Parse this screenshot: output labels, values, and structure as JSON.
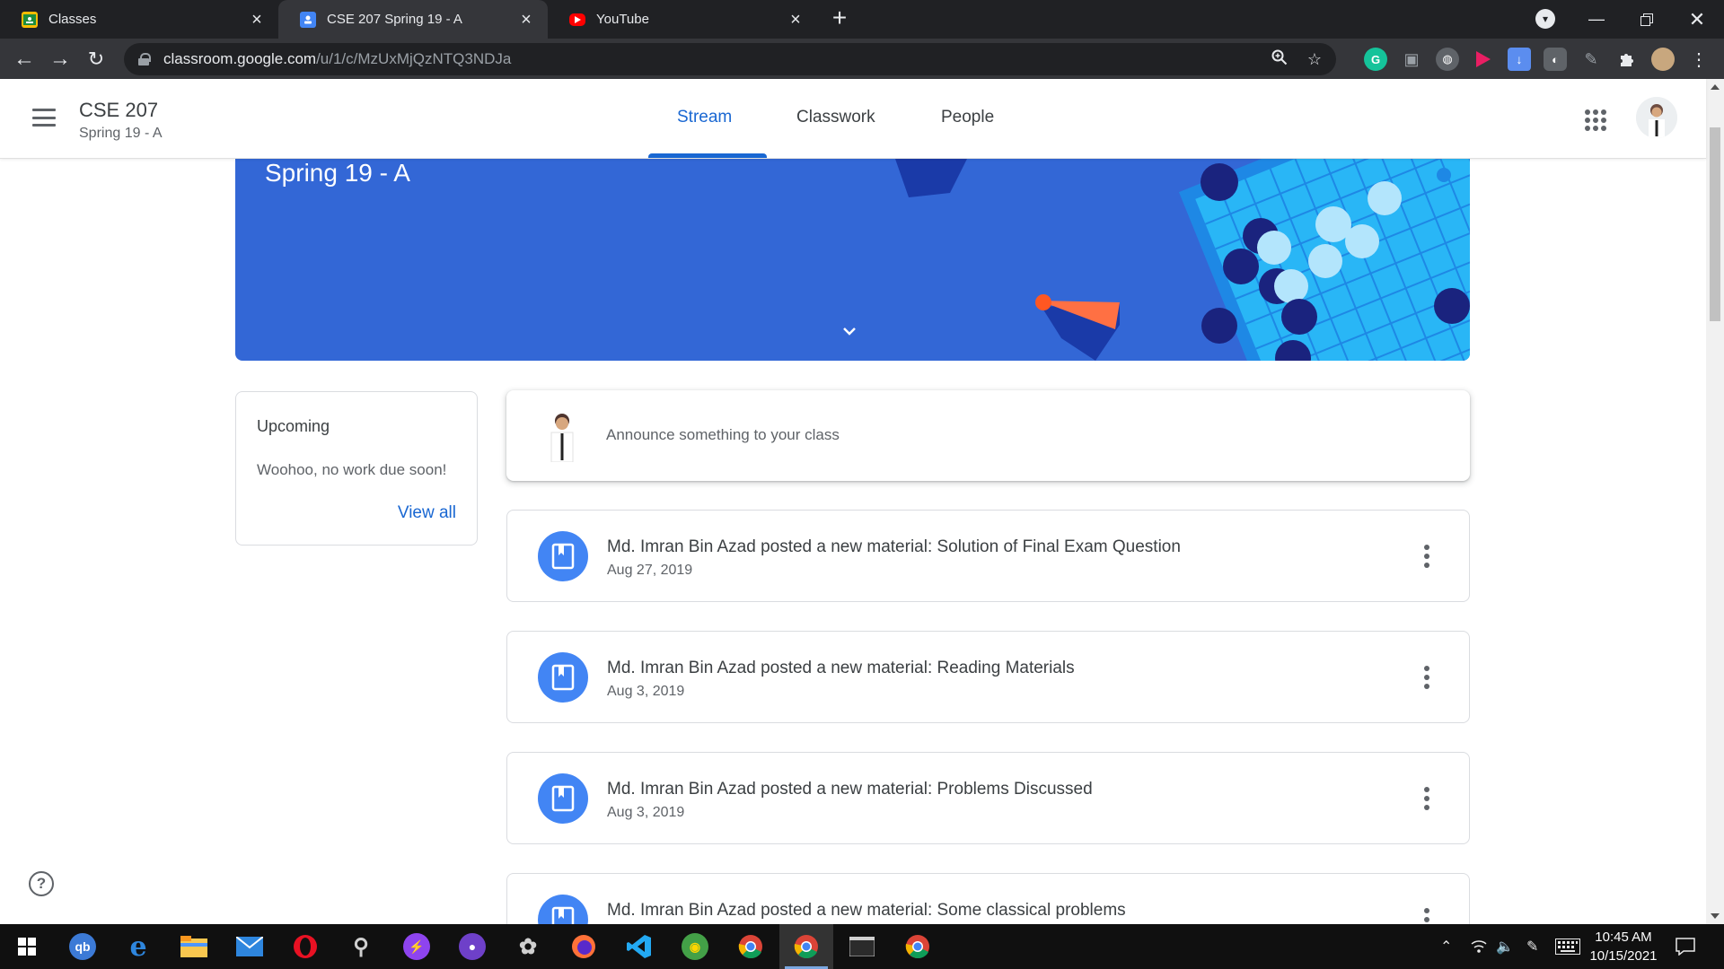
{
  "browser": {
    "tabs": [
      {
        "title": "Classes",
        "favicon_color": "#fbbc04"
      },
      {
        "title": "CSE 207 Spring 19 - A",
        "favicon_color": "#4285f4"
      },
      {
        "title": "YouTube",
        "favicon_color": "#ff0000"
      }
    ],
    "url_host": "classroom.google.com",
    "url_path": "/u/1/c/MzUxMjQzNTQ3NDJa"
  },
  "header": {
    "class_name": "CSE 207",
    "class_section": "Spring 19 - A",
    "tabs": [
      "Stream",
      "Classwork",
      "People"
    ],
    "active_tab": "Stream"
  },
  "banner": {
    "title": "Spring 19 - A",
    "color": "#3367d6"
  },
  "upcoming": {
    "title": "Upcoming",
    "empty_text": "Woohoo, no work due soon!",
    "view_all": "View all"
  },
  "announce": {
    "placeholder": "Announce something to your class"
  },
  "posts": [
    {
      "title": "Md. Imran Bin Azad posted a new material: Solution of Final Exam Question",
      "date": "Aug 27, 2019"
    },
    {
      "title": "Md. Imran Bin Azad posted a new material: Reading Materials",
      "date": "Aug 3, 2019"
    },
    {
      "title": "Md. Imran Bin Azad posted a new material: Problems Discussed",
      "date": "Aug 3, 2019"
    },
    {
      "title": "Md. Imran Bin Azad posted a new material: Some classical problems",
      "date": ""
    }
  ],
  "taskbar": {
    "time": "10:45 AM",
    "date": "10/15/2021"
  },
  "colors": {
    "accent": "#1967d2",
    "post_icon": "#4285f4"
  }
}
